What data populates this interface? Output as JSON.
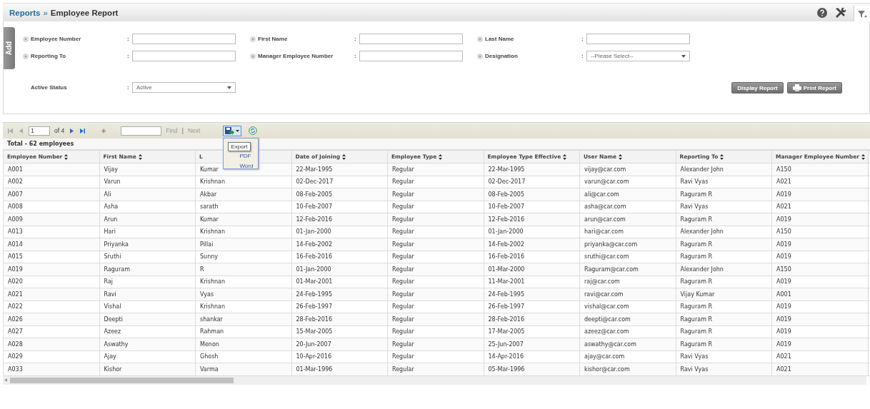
{
  "breadcrumb": {
    "parent": "Reports",
    "separator": "»",
    "current": "Employee Report"
  },
  "side_tab": {
    "label": "Add"
  },
  "filters": [
    {
      "label": "Employee Number",
      "separator": ":",
      "kind": "text",
      "removable": true
    },
    {
      "label": "First Name",
      "separator": ":",
      "kind": "text",
      "removable": true
    },
    {
      "label": "Last Name",
      "separator": ":",
      "kind": "text",
      "removable": true
    },
    {
      "label": "Reporting To",
      "separator": ":",
      "kind": "text",
      "removable": true
    },
    {
      "label": "Manager Employee Number",
      "separator": ":",
      "kind": "text",
      "removable": true
    },
    {
      "label": "Designation",
      "separator": ":",
      "kind": "select",
      "removable": true,
      "placeholder": "--Please Select--"
    },
    {
      "label": "Active Status",
      "separator": ":",
      "kind": "select",
      "removable": false,
      "value": "Active"
    }
  ],
  "buttons": [
    {
      "label": "Display Report",
      "kind": "plain"
    },
    {
      "label": "Print Report",
      "kind": "print"
    }
  ],
  "toolbar": {
    "page": "1",
    "page_count": "of 4",
    "find": "Find",
    "separator": "|",
    "next": "Next",
    "export": {
      "expanded": true,
      "tooltip": "Export",
      "items": [
        "PDF",
        "Word"
      ]
    }
  },
  "total": "Total - 62 employees",
  "table": {
    "columns": [
      {
        "label": "Employee Number",
        "sort_icon": true
      },
      {
        "label": "First Name",
        "sort_icon": true
      },
      {
        "label": "L",
        "sort_icon": false
      },
      {
        "label": "Date of Joining",
        "sort_icon": true
      },
      {
        "label": "Employee Type",
        "sort_icon": true
      },
      {
        "label": "Employee Type Effective",
        "sort_icon": true
      },
      {
        "label": "User Name",
        "sort_icon": true
      },
      {
        "label": "Reporting To",
        "sort_icon": true
      },
      {
        "label": "Manager Employee Number",
        "sort_icon": true
      }
    ],
    "rows": [
      [
        "A001",
        "Vijay",
        "Kumar",
        "22-Mar-1995",
        "Regular",
        "22-Mar-1995",
        "vijay@car.com",
        "Alexander John",
        "A150"
      ],
      [
        "A002",
        "Varun",
        "Krishnan",
        "02-Dec-2017",
        "Regular",
        "02-Dec-2017",
        "varun@car.com",
        "Ravi Vyas",
        "A021"
      ],
      [
        "A007",
        "Ali",
        "Akbar",
        "08-Feb-2005",
        "Regular",
        "08-Feb-2005",
        "ali@car.com",
        "Raguram R",
        "A019"
      ],
      [
        "A008",
        "Asha",
        "sarath",
        "10-Feb-2007",
        "Regular",
        "10-Feb-2007",
        "asha@car.com",
        "Ravi Vyas",
        "A021"
      ],
      [
        "A009",
        "Arun",
        "Kumar",
        "12-Feb-2016",
        "Regular",
        "12-Feb-2016",
        "arun@car.com",
        "Raguram R",
        "A019"
      ],
      [
        "A013",
        "Hari",
        "Krishnan",
        "01-Jan-2000",
        "Regular",
        "01-Jan-2000",
        "hari@car.com",
        "Alexander John",
        "A150"
      ],
      [
        "A014",
        "Priyanka",
        "Pillai",
        "14-Feb-2002",
        "Regular",
        "14-Feb-2002",
        "priyanka@car.com",
        "Raguram R",
        "A019"
      ],
      [
        "A015",
        "Sruthi",
        "Sunny",
        "16-Feb-2016",
        "Regular",
        "16-Feb-2016",
        "sruthi@car.com",
        "Raguram R",
        "A019"
      ],
      [
        "A019",
        "Raguram",
        "R",
        "01-Jan-2000",
        "Regular",
        "01-Mar-2000",
        "Raguram@car.com",
        "Alexander John",
        "A150"
      ],
      [
        "A020",
        "Raj",
        "Krishnan",
        "01-Mar-2001",
        "Regular",
        "11-Mar-2001",
        "raj@car.com",
        "Raguram R",
        "A019"
      ],
      [
        "A021",
        "Ravi",
        "Vyas",
        "24-Feb-1995",
        "Regular",
        "24-Feb-1995",
        "ravi@car.com",
        "Vijay Kumar",
        "A001"
      ],
      [
        "A022",
        "Vishal",
        "Krishnan",
        "26-Feb-1997",
        "Regular",
        "26-Feb-1997",
        "vishal@car.com",
        "Raguram R",
        "A019"
      ],
      [
        "A026",
        "Deepti",
        "shankar",
        "28-Feb-2016",
        "Regular",
        "28-Feb-2016",
        "deepti@car.com",
        "Raguram R",
        "A019"
      ],
      [
        "A027",
        "Azeez",
        "Rahman",
        "15-Mar-2005",
        "Regular",
        "17-Mar-2005",
        "azeez@car.com",
        "Raguram R",
        "A019"
      ],
      [
        "A028",
        "Aswathy",
        "Menon",
        "20-Jun-2007",
        "Regular",
        "25-Jun-2007",
        "aswathy@car.com",
        "Raguram R",
        "A019"
      ],
      [
        "A029",
        "Ajay",
        "Ghosh",
        "10-Apr-2016",
        "Regular",
        "14-Apr-2016",
        "ajay@car.com",
        "Ravi Vyas",
        "A021"
      ],
      [
        "A033",
        "Kishor",
        "Varma",
        "01-Mar-1996",
        "Regular",
        "05-Mar-1996",
        "kishor@car.com",
        "Ravi Vyas",
        "A021"
      ]
    ]
  }
}
